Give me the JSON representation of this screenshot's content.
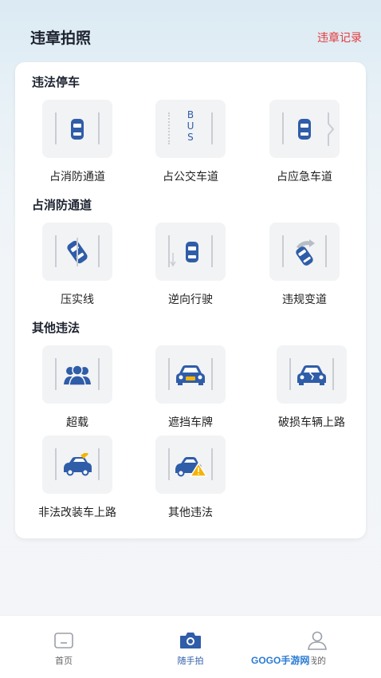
{
  "header": {
    "title": "违章拍照",
    "record_link": "违章记录"
  },
  "sections": [
    {
      "title": "违法停车",
      "items": [
        "占消防通道",
        "占公交车道",
        "占应急车道"
      ]
    },
    {
      "title": "占消防通道",
      "items": [
        "压实线",
        "逆向行驶",
        "违规变道"
      ]
    },
    {
      "title": "其他违法",
      "items": [
        "超载",
        "遮挡车牌",
        "破损车辆上路",
        "非法改装车上路",
        "其他违法"
      ]
    }
  ],
  "bus_lane_text": "BUS",
  "tabbar": {
    "home": "首页",
    "camera": "随手拍",
    "mine": "我的"
  },
  "watermark": "GOGO手游网",
  "colors": {
    "accent": "#2f5da8",
    "danger": "#e5393c",
    "warning": "#f5b400"
  }
}
